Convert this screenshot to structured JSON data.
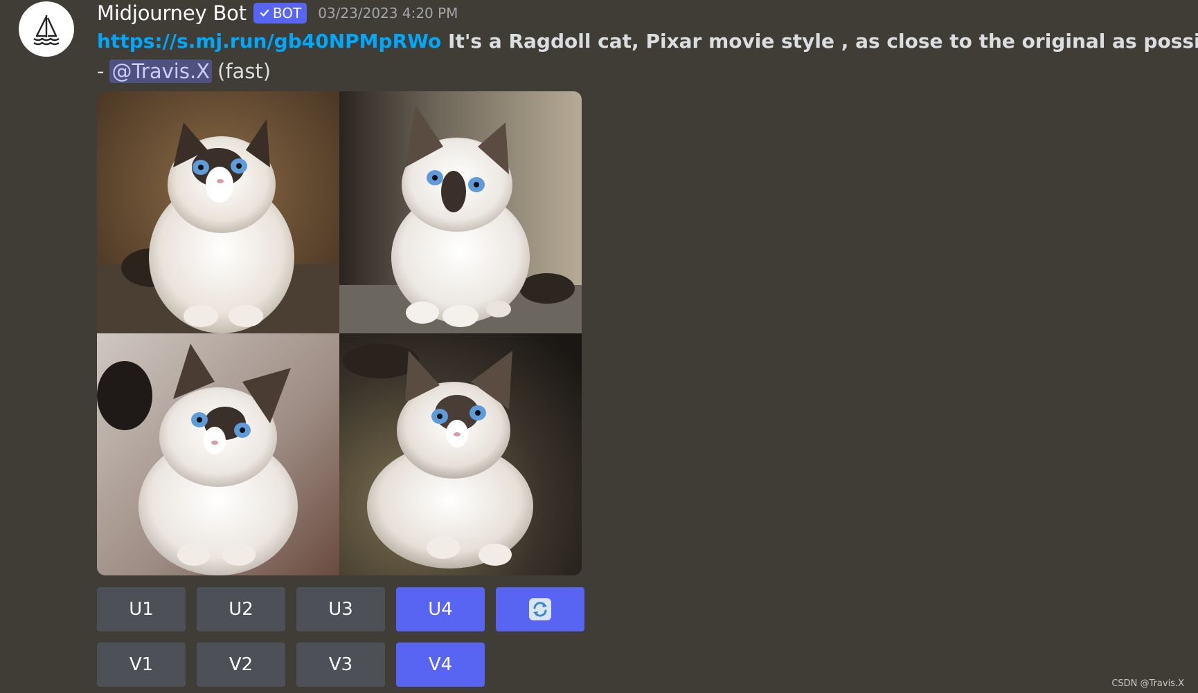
{
  "message": {
    "author": "Midjourney Bot",
    "badge": "BOT",
    "badge_icon": "checkmark-icon",
    "timestamp": "03/23/2023 4:20 PM",
    "link": "https://s.mj.run/gb40NPMpRWo",
    "prompt": "It's a Ragdoll cat,   Pixar movie style , as close to the original as possible",
    "dash": "-",
    "mention": "@Travis.X",
    "mode": "(fast)"
  },
  "images": [
    {
      "label": "ragdoll kitten 1"
    },
    {
      "label": "ragdoll kitten 2"
    },
    {
      "label": "ragdoll kitten 3"
    },
    {
      "label": "ragdoll kitten 4"
    }
  ],
  "buttons": {
    "u1": "U1",
    "u2": "U2",
    "u3": "U3",
    "u4": "U4",
    "reroll_icon": "refresh-icon",
    "v1": "V1",
    "v2": "V2",
    "v3": "V3",
    "v4": "V4"
  },
  "colors": {
    "background": "#403d37",
    "button_gray": "#4e5058",
    "button_blue": "#5865f2",
    "link": "#00a8fc",
    "mention_bg": "#4f527f"
  },
  "watermark": "CSDN @Travis.X"
}
